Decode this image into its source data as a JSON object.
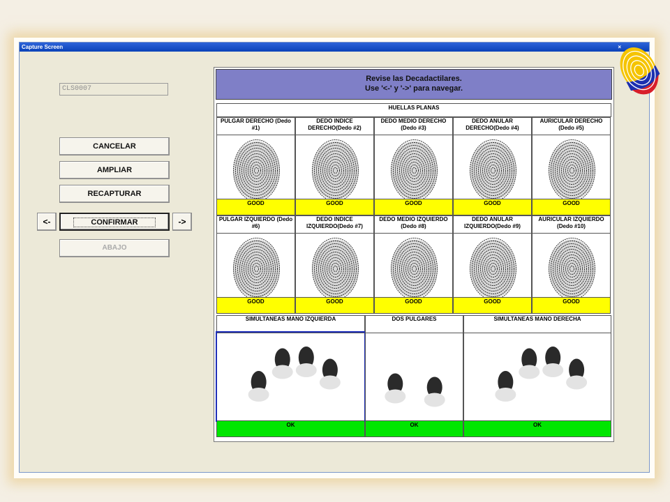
{
  "window": {
    "title": "Capture Screen",
    "close_glyph": "×"
  },
  "record_id": "CLS0007",
  "buttons": {
    "cancelar": "CANCELAR",
    "ampliar": "AMPLIAR",
    "recapturar": "RECAPTURAR",
    "confirmar": "CONFIRMAR",
    "prev": "<-",
    "next": "->",
    "abajo": "ABAJO"
  },
  "header": {
    "line1": "Revise las Decadactilares.",
    "line2": "Use '<-' y '->' para navegar."
  },
  "section_title": "HUELLAS PLANAS",
  "row1": [
    {
      "label": "PULGAR DERECHO (Dedo #1)",
      "status": "GOOD"
    },
    {
      "label": "DEDO INDICE DERECHO(Dedo #2)",
      "status": "GOOD"
    },
    {
      "label": "DEDO MEDIO DERECHO (Dedo #3)",
      "status": "GOOD"
    },
    {
      "label": "DEDO ANULAR DERECHO(Dedo #4)",
      "status": "GOOD"
    },
    {
      "label": "AURICULAR DERECHO (Dedo #5)",
      "status": "GOOD"
    }
  ],
  "row2": [
    {
      "label": "PULGAR IZQUIERDO (Dedo #6)",
      "status": "GOOD"
    },
    {
      "label": "DEDO INDICE IZQUIERDO(Dedo #7)",
      "status": "GOOD"
    },
    {
      "label": "DEDO MEDIO IZQUIERDO (Dedo #8)",
      "status": "GOOD"
    },
    {
      "label": "DEDO ANULAR IZQUIERDO(Dedo #9)",
      "status": "GOOD"
    },
    {
      "label": "AURICULAR IZQUIERDO (Dedo #10)",
      "status": "GOOD"
    }
  ],
  "slaps": [
    {
      "label": "SIMULTANEAS MANO IZQUIERDA",
      "status": "OK"
    },
    {
      "label": "DOS PULGARES",
      "status": "OK"
    },
    {
      "label": "SIMULTANEAS MANO DERECHA",
      "status": "OK"
    }
  ],
  "colors": {
    "good": "#ffff00",
    "ok": "#00e600",
    "header": "#7f7fc7",
    "selected": "#1f2fb8"
  }
}
